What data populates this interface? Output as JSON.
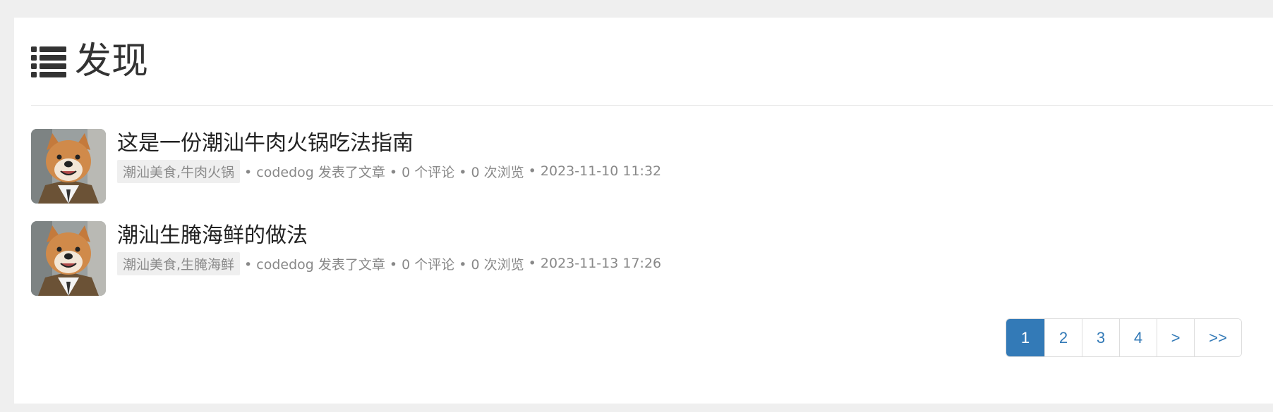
{
  "header": {
    "title": "发现",
    "icon": "list-icon"
  },
  "posts": [
    {
      "title": "这是一份潮汕牛肉火锅吃法指南",
      "tags": "潮汕美食,牛肉火锅",
      "author_action": "• codedog 发表了文章",
      "comments": "• 0 个评论",
      "views": "• 0 次浏览",
      "time": "• 2023-11-10 11:32",
      "avatar_icon": "dog-avatar-icon"
    },
    {
      "title": "潮汕生腌海鲜的做法",
      "tags": "潮汕美食,生腌海鲜",
      "author_action": "• codedog 发表了文章",
      "comments": "• 0 个评论",
      "views": "• 0 次浏览",
      "time": "• 2023-11-13 17:26",
      "avatar_icon": "dog-avatar-icon"
    }
  ],
  "pagination": {
    "pages": [
      "1",
      "2",
      "3",
      "4"
    ],
    "next": ">",
    "last": ">>",
    "active": "1"
  },
  "colors": {
    "accent": "#337ab7",
    "background": "#efefef",
    "panel": "#ffffff",
    "meta_text": "#888888"
  }
}
